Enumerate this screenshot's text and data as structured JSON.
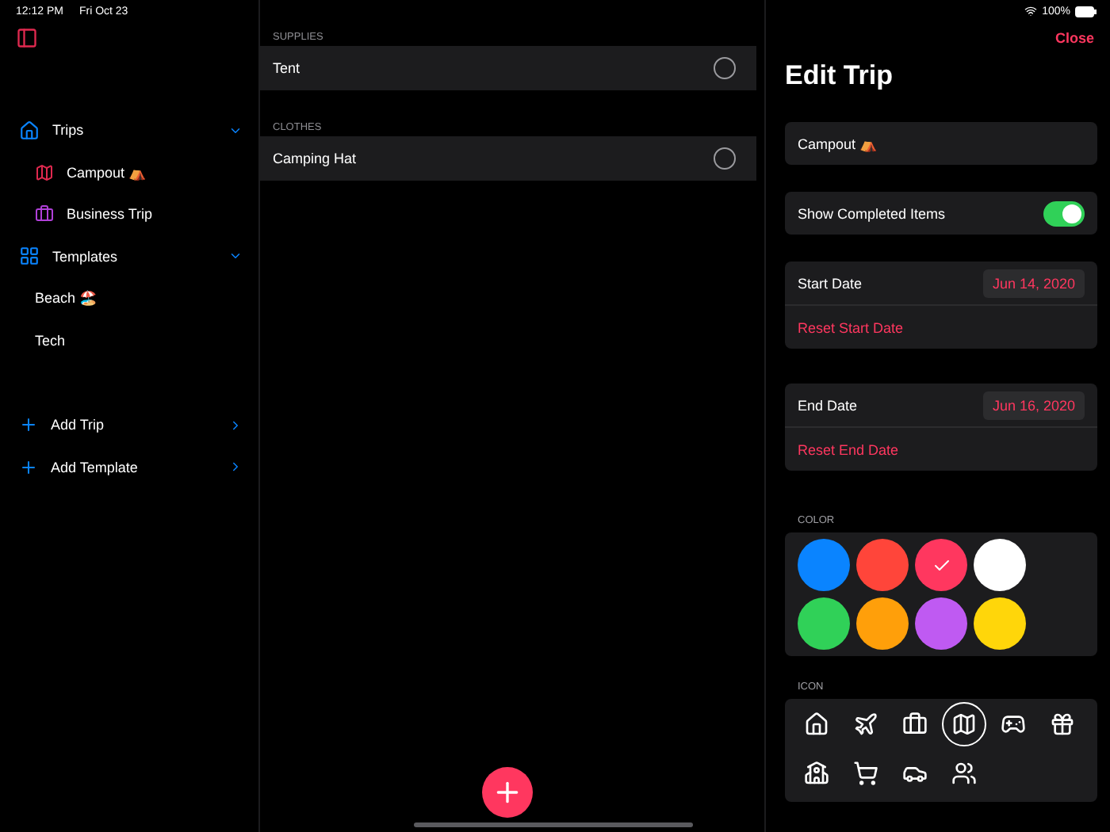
{
  "status_bar": {
    "time": "12:12 PM",
    "date": "Fri Oct 23",
    "battery": "100%"
  },
  "sidebar": {
    "groups": [
      {
        "label": "Trips",
        "expanded": true,
        "children": [
          {
            "label": "Campout ⛺",
            "color": "#e0294f"
          },
          {
            "label": "Business Trip",
            "color": "#b040d8"
          }
        ]
      },
      {
        "label": "Templates",
        "expanded": true,
        "children": [
          {
            "label": "Beach 🏖️"
          },
          {
            "label": "Tech"
          }
        ]
      }
    ],
    "actions": [
      {
        "label": "Add Trip"
      },
      {
        "label": "Add Template"
      }
    ]
  },
  "item_list": {
    "sections": [
      {
        "header": "SUPPLIES",
        "items": [
          {
            "label": "Tent",
            "checked": false
          }
        ]
      },
      {
        "header": "CLOTHES",
        "items": [
          {
            "label": "Camping Hat",
            "checked": false
          }
        ]
      }
    ]
  },
  "edit_panel": {
    "close": "Close",
    "title": "Edit Trip",
    "name_value": "Campout ⛺",
    "show_completed": {
      "label": "Show Completed Items",
      "on": true
    },
    "dates": [
      {
        "label": "Start Date",
        "value": "Jun 14, 2020",
        "reset": "Reset Start Date"
      },
      {
        "label": "End Date",
        "value": "Jun 16, 2020",
        "reset": "Reset End Date"
      }
    ],
    "color_header": "COLOR",
    "colors": [
      {
        "color": "#0a84ff",
        "selected": false
      },
      {
        "color": "#ff453a",
        "selected": false
      },
      {
        "color": "#ff375f",
        "selected": true
      },
      {
        "color": "#ffffff",
        "selected": false
      },
      {
        "color": "#30d158",
        "selected": false
      },
      {
        "color": "#ff9f0a",
        "selected": false
      },
      {
        "color": "#bf5af2",
        "selected": false
      },
      {
        "color": "#ffd60a",
        "selected": false
      }
    ],
    "icon_header": "ICON",
    "icons": [
      {
        "selected": false
      },
      {
        "selected": false
      },
      {
        "selected": false
      },
      {
        "selected": true
      },
      {
        "selected": false
      },
      {
        "selected": false
      },
      {
        "selected": false
      },
      {
        "selected": false
      },
      {
        "selected": false
      },
      {
        "selected": false
      }
    ]
  }
}
